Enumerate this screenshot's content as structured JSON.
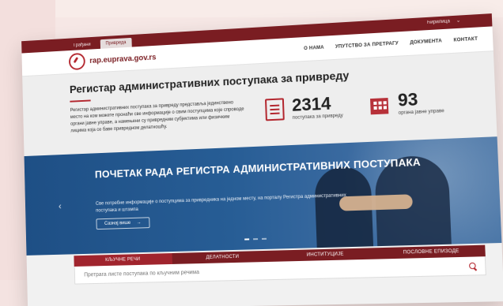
{
  "top": {
    "tabs": [
      {
        "label": "Грађани",
        "active": false
      },
      {
        "label": "Привреда",
        "active": true
      }
    ],
    "language": "Ћирилица"
  },
  "header": {
    "logo_text": "rap.euprava.gov.rs",
    "nav": [
      "О НАМА",
      "УПУТСТВО ЗА ПРЕТРАГУ",
      "ДОКУМЕНТА",
      "КОНТАКТ"
    ]
  },
  "hero": {
    "title": "Регистар административних поступака за привреду",
    "description": "Регистар административних поступака за привреду представља јединствено место на ком можете пронаћи све информације о свим поступцима које спроводе органи јавне управе, а намењени су привредним субјектима или физичким лицима која се баве привредном делатношћу.",
    "stats": [
      {
        "value": "2314",
        "label": "поступака за привреду",
        "icon": "document-icon"
      },
      {
        "value": "93",
        "label": "органа јавне управе",
        "icon": "building-icon"
      }
    ]
  },
  "banner": {
    "title": "ПОЧЕТАК РАДА РЕГИСТРА АДМИНИСТРАТИВНИХ ПОСТУПАКА",
    "subtitle": "Све потребне информације о поступцима за привредника на једном месту, на порталу Регистра административних поступака и штампа",
    "cta": "Сазнај више"
  },
  "search": {
    "tabs": [
      "КЉУЧНЕ РЕЧИ",
      "ДЕЛАТНОСТИ",
      "ИНСТИТУЦИЈЕ",
      "ПОСЛОВНЕ ЕПИЗОДЕ"
    ],
    "active_tab": 0,
    "placeholder": "Претрага листе поступака по кључним речима"
  },
  "colors": {
    "brand": "#7a1d22",
    "accent": "#b3262e",
    "banner": "#275d95"
  }
}
